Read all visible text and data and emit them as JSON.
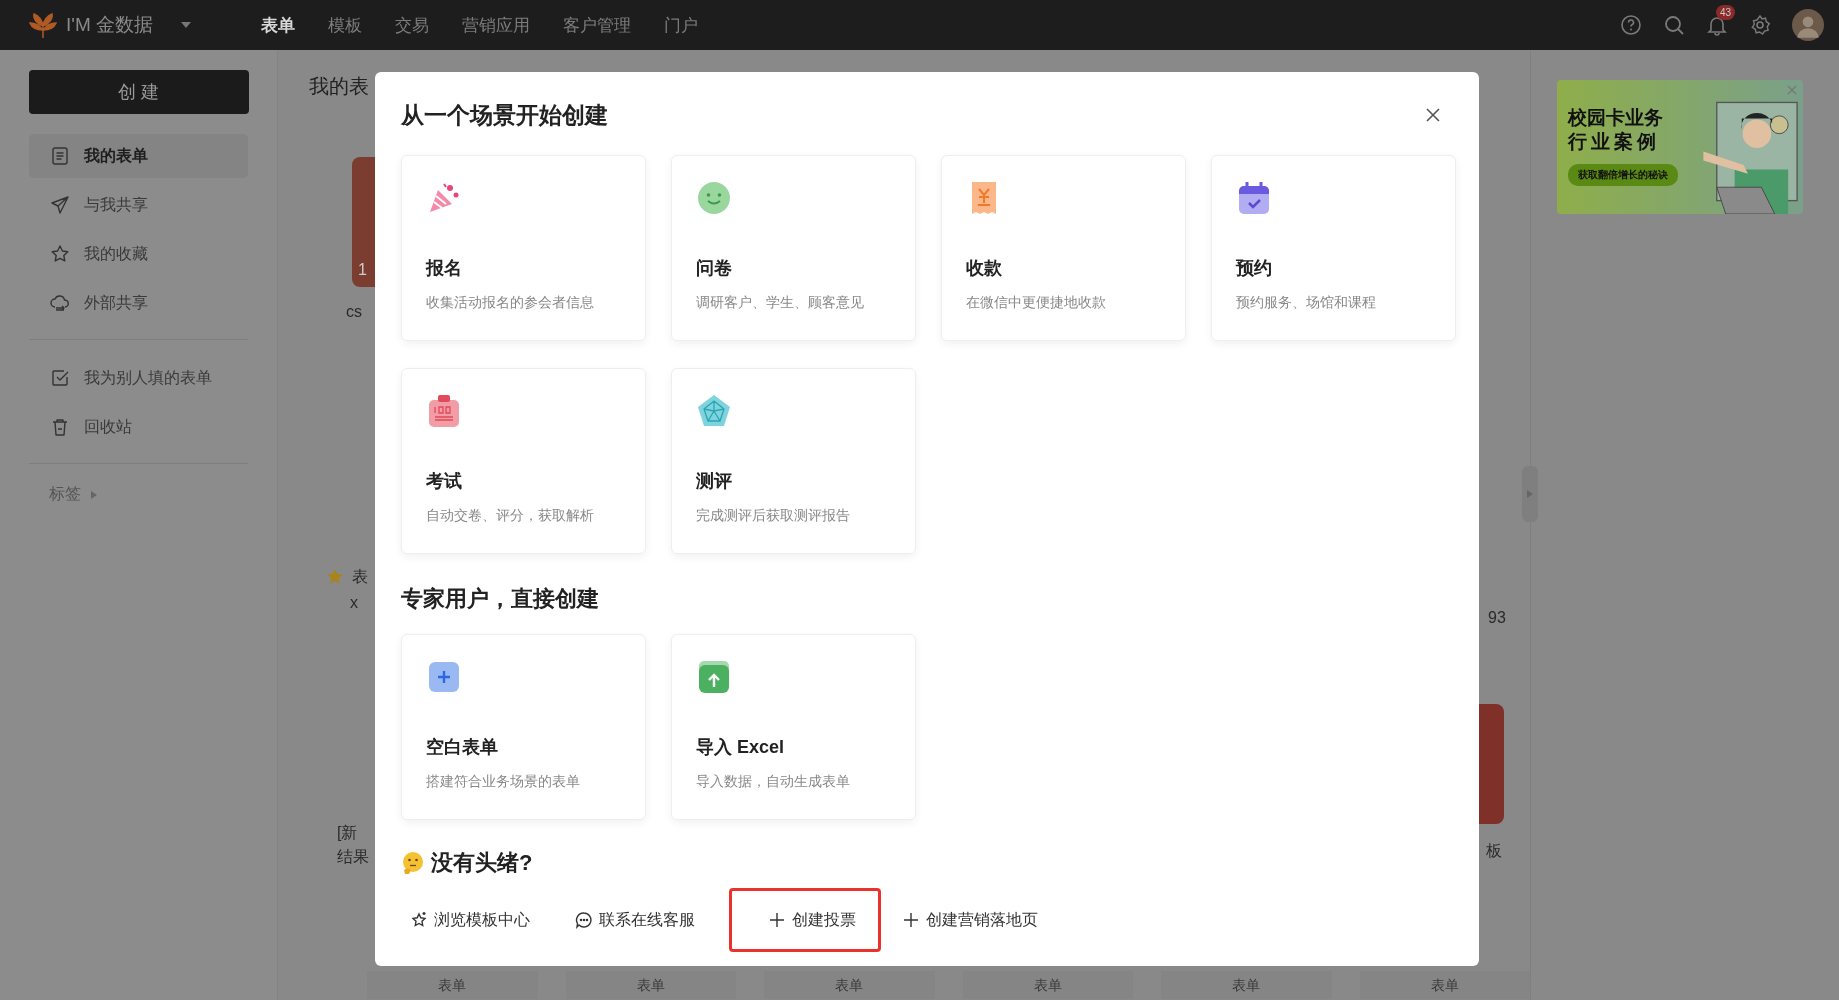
{
  "app": {
    "logo_text": "I'M 金数据",
    "notification_badge": "43"
  },
  "nav": [
    {
      "label": "表单",
      "selected": true
    },
    {
      "label": "模板",
      "selected": false
    },
    {
      "label": "交易",
      "selected": false
    },
    {
      "label": "营销应用",
      "selected": false
    },
    {
      "label": "客户管理",
      "selected": false
    },
    {
      "label": "门户",
      "selected": false
    }
  ],
  "sidebar": {
    "create_button": "创 建",
    "groups": [
      [
        {
          "kind": "doc",
          "label": "我的表单",
          "selected": true
        },
        {
          "kind": "send",
          "label": "与我共享",
          "selected": false
        },
        {
          "kind": "star",
          "label": "我的收藏",
          "selected": false
        },
        {
          "kind": "cloud",
          "label": "外部共享",
          "selected": false
        }
      ],
      [
        {
          "kind": "check",
          "label": "我为别人填的表单",
          "selected": false
        },
        {
          "kind": "trash",
          "label": "回收站",
          "selected": false
        }
      ]
    ],
    "tags_label": "标签"
  },
  "background": {
    "heading": "我的表",
    "left": {
      "card_number": "1",
      "card_title": "cs",
      "starred": true,
      "starred_title": "表",
      "starred_subtitle": "x",
      "bottom_title_1": "[新",
      "bottom_title_2": "结果"
    },
    "right": {
      "text": "93",
      "title": "板"
    },
    "tab_labels": [
      "表单",
      "表单",
      "表单",
      "表单",
      "表单",
      "表单"
    ]
  },
  "ad": {
    "title_line_1": "校园卡业务",
    "title_line_2": "行业案例",
    "button": "获取翻倍增长的秘诀"
  },
  "modal": {
    "title": "从一个场景开始创建",
    "scenarios": [
      {
        "kind": "party",
        "name": "报名",
        "description": "收集活动报名的参会者信息"
      },
      {
        "kind": "smile",
        "name": "问卷",
        "description": "调研客户、学生、顾客意见"
      },
      {
        "kind": "receipt",
        "name": "收款",
        "description": "在微信中更便捷地收款"
      },
      {
        "kind": "calendar",
        "name": "预约",
        "description": "预约服务、场馆和课程"
      },
      {
        "kind": "exam",
        "name": "考试",
        "description": "自动交卷、评分，获取解析"
      },
      {
        "kind": "pentagon",
        "name": "测评",
        "description": "完成测评后获取测评报告"
      }
    ],
    "expert_title": "专家用户，直接创建",
    "expert": [
      {
        "kind": "plus",
        "name": "空白表单",
        "description": "搭建符合业务场景的表单"
      },
      {
        "kind": "upload",
        "name": "导入 Excel",
        "description": "导入数据，自动生成表单"
      }
    ],
    "help_title": "没有头绪?",
    "links": [
      {
        "kind": "star",
        "label": "浏览模板中心",
        "highlighted": false
      },
      {
        "kind": "chat",
        "label": "联系在线客服",
        "highlighted": false
      },
      {
        "kind": "plus",
        "label": "创建投票",
        "highlighted": true
      },
      {
        "kind": "plus",
        "label": "创建营销落地页",
        "highlighted": false
      }
    ]
  }
}
